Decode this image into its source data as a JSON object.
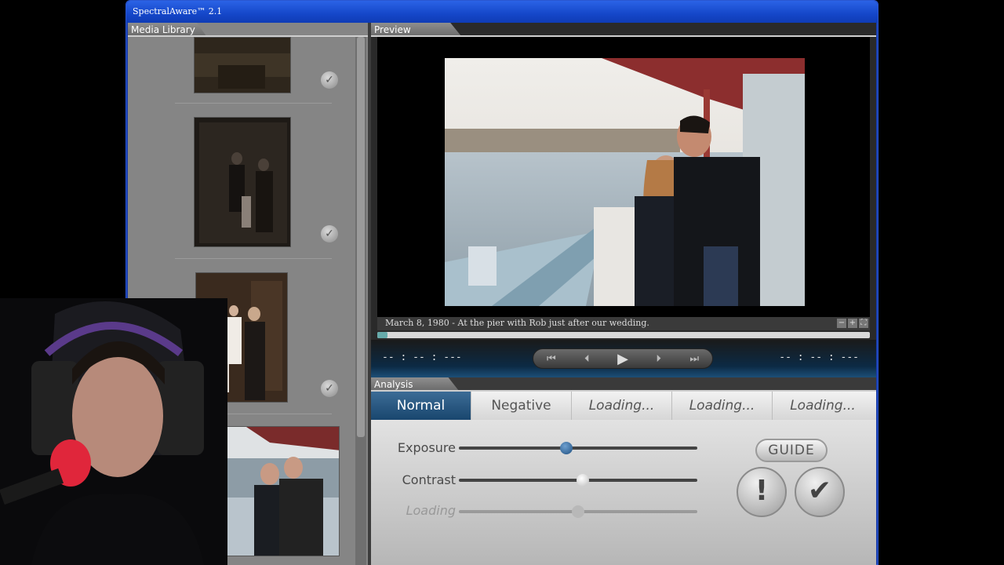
{
  "window": {
    "title": "SpectralAware™ 2.1"
  },
  "library": {
    "label": "Media Library",
    "items": [
      {
        "name": "tintype-photo-1",
        "checked": true
      },
      {
        "name": "tintype-family-photo",
        "checked": true
      },
      {
        "name": "family-portrait-photo",
        "checked": true
      },
      {
        "name": "pier-couple-photo",
        "checked": false
      }
    ]
  },
  "preview": {
    "label": "Preview",
    "caption": "March 8, 1980 - At the pier with Rob just after our wedding.",
    "zoom_out": "−",
    "zoom_in": "+",
    "fullscreen": "⛶",
    "progress": 0.02,
    "timecode_left": "-- : -- : ---",
    "timecode_right": "-- : -- : ---",
    "controls": {
      "first": "⏮",
      "prev": "⏴",
      "play": "▶",
      "next": "⏵",
      "last": "⏭"
    }
  },
  "analysis": {
    "label": "Analysis",
    "tabs": [
      {
        "label": "Normal",
        "active": true
      },
      {
        "label": "Negative",
        "active": false
      },
      {
        "label": "Loading...",
        "active": false
      },
      {
        "label": "Loading...",
        "active": false
      },
      {
        "label": "Loading...",
        "active": false
      }
    ],
    "sliders": [
      {
        "label": "Exposure",
        "value": 0.45
      },
      {
        "label": "Contrast",
        "value": 0.52
      },
      {
        "label": "Loading",
        "value": 0.5
      }
    ],
    "guide_label": "GUIDE",
    "alert_label": "!",
    "confirm_label": "✔"
  },
  "colors": {
    "titlebar": "#1547c9",
    "active_tab": "#2a5985",
    "accent_knob": "#2d5d8e"
  }
}
